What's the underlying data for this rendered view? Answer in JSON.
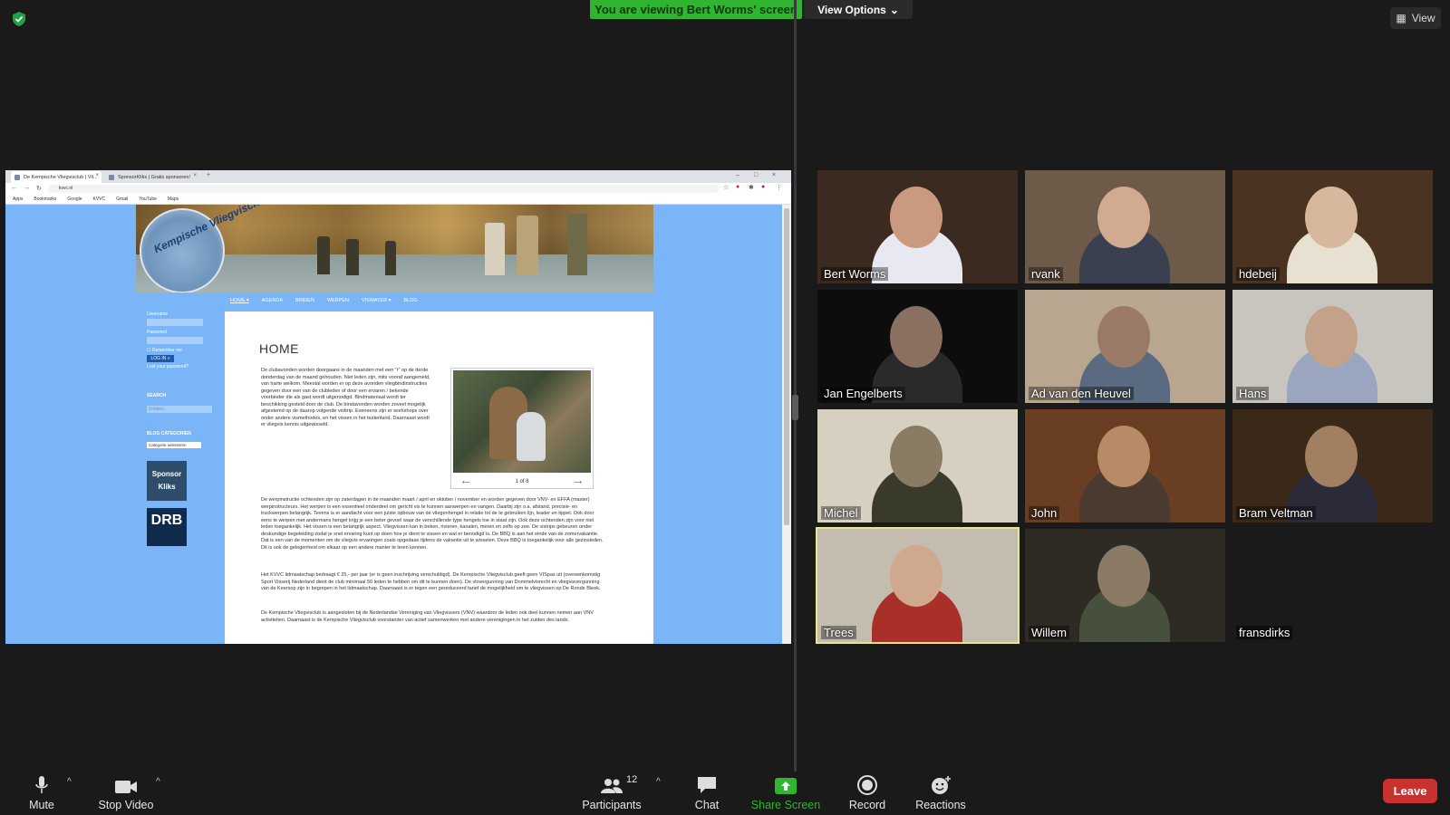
{
  "top": {
    "banner": "You are viewing Bert Worms' screen",
    "view_options": "View Options",
    "view_button": "View"
  },
  "browser": {
    "tabs": [
      "De Kempische Vliegvisclub | Vli...",
      "SponsorKliks | Gratis sponsoren!"
    ],
    "url": "kvvc.nl",
    "bookmarks": [
      "Apps",
      "Bookmarks",
      "Google",
      "KVVC",
      "Gmail",
      "YouTube",
      "Maps"
    ]
  },
  "site": {
    "logo_text": "Kempische Vliegvisclub",
    "nav": [
      "HOME ▾",
      "AGENDA",
      "BINDEN",
      "WERPEN",
      "VISWATER ▾",
      "BLOG"
    ],
    "sidebar": {
      "username": "Username",
      "password": "Password",
      "remember": "Remember me",
      "login": "LOG IN »",
      "lost": "Lost your password?",
      "search_head": "SEARCH",
      "search_placeholder": "Zoeken...",
      "blog_head": "BLOG CATEGORIEN",
      "category_select": "Categorie selecteren",
      "sponsor": "Sponsor Kliks",
      "drb": "DRB"
    },
    "title": "HOME",
    "para1": "De clubavonden worden doorgaans in de maanden met een \"r\" op de derde donderdag van de maand gehouden. Niet leden zijn, mits vooraf aangemeld, van harte welkom. Meestal worden er op deze avonden vliegbindinstructies gegeven door een van de clubleden of door een ervaren / bekende voorbinder die als gast wordt uitgenodigd. Bindmateriaal wordt ter beschikking gesteld door de club. De bindavonden worden zoveel mogelijk afgestemd op de daarop volgende visttrip. Eveneens zijn er workshops over onder andere vismethodes, en het vissen in het buitenland. Daarnaast wordt er vliegvis kennis uitgewisseld.",
    "slide_counter": "1 of 8",
    "para2": "De werpinstructie ochtenden zijn op zaterdagen in de maanden maart / april en oktober / november en worden gegeven door VNV- en EFFA (master) werpinstructeurs. Het werpen is een essentieel onderdeel om gericht vis te kunnen aanwerpen en vangen. Daarbij zijn o.a. afstand, precisie- en truckwerpen belangrijk. Tevens is er aandacht voor een juiste opbouw van de vliegenhengel in relatie tot de te gebruiken lijn, leader en tippet. Ook door eens te werpen met andermans hengel krijg je een beter gevoel waar de verschillende type hengels toe in staat zijn. Ook deze ochtenden zijn voor niet leden toegankelijk. Het vissen is een belangrijk aspect. Vliegvissen kan in beken, rivieren, kanalen, meren en zelfs op zee. De vistrips gebeuren onder deskundige begeleiding zodat je snel ervaring kunt op doen hoe je dient te vissen en wat er benodigd is. De BBQ is aan het einde van de zomervakantie. Dat is een van de momenten om de vliegvis ervaringen zoals opgedaan tijdens de vakantie uit te wisselen. Deze BBQ is toegankelijk voor alle gezinsleden. Dit is ook de gelegenheid om elkaar op een andere manier te leren kennen.",
    "para3": "Het KVVC lidmaatschap bedraagt € 25,- per jaar (er is geen inschrijving verschuldigd). De Kempische Vliegvisclub geeft geen VISpas uit (overeenkomstig Sport Visserij Nederland dient de club minimaal 50 leden te hebben om dit te kunnen doen). De vlovergunning van Dommelvisrecht en vliegvisvergunning van de Keersop zijn in begrepen in het lidmaatschap. Daarnaast is er tegen een gereduceerd tarief de mogelijkheid om te vliegvissen op De Ronde Bleek.",
    "para4": "De Kempische Vliegvisclub is aangesloten bij de Nederlandse Vereniging van Vliegvissers (VNV) waardoor de leden ook deel kunnen nemen aan VNV activiteiten. Daarnaast is de Kempische Vliegvisclub voorstander van actief samenwerken met andere verenigingen in het zuiden des lands."
  },
  "participants": [
    {
      "name": "Bert Worms",
      "bg": "#3b2a20",
      "skin": "#c99a80",
      "shirt": "#e8e8f0"
    },
    {
      "name": "rvank",
      "bg": "#6e5a48",
      "skin": "#d1aa90",
      "shirt": "#3a4050"
    },
    {
      "name": "hdebeij",
      "bg": "#4a3320",
      "skin": "#d8b89c",
      "shirt": "#e8e0d0"
    },
    {
      "name": "Jan Engelberts",
      "bg": "#0d0d0d",
      "skin": "#8a7060",
      "shirt": "#2a2a2a"
    },
    {
      "name": "Ad van den Heuvel",
      "bg": "#b8a690",
      "skin": "#9a7a66",
      "shirt": "#5a6a80"
    },
    {
      "name": "Hans",
      "bg": "#c8c4be",
      "skin": "#c4a28a",
      "shirt": "#9aa6c0"
    },
    {
      "name": "Michel",
      "bg": "#d6d0c0",
      "skin": "#8a7c62",
      "shirt": "#3a3a2a"
    },
    {
      "name": "John",
      "bg": "#6a3e22",
      "skin": "#b88a66",
      "shirt": "#4a3a30"
    },
    {
      "name": "Bram Veltman",
      "bg": "#3a2818",
      "skin": "#a08060",
      "shirt": "#2a2a38"
    },
    {
      "name": "Trees",
      "bg": "#c4bcae",
      "skin": "#cfa88e",
      "shirt": "#a83028"
    },
    {
      "name": "Willem",
      "bg": "#2e2a24",
      "skin": "#8a7a66",
      "shirt": "#46503c"
    },
    {
      "name": "fransdirks",
      "bg": "#1a1a1a",
      "skin": "",
      "shirt": ""
    }
  ],
  "toolbar": {
    "mute": "Mute",
    "stop_video": "Stop Video",
    "participants": "Participants",
    "participants_count": "12",
    "chat": "Chat",
    "share_screen": "Share Screen",
    "record": "Record",
    "reactions": "Reactions",
    "leave": "Leave"
  },
  "colors": {
    "accent_green": "#2fb52f",
    "leave_red": "#c7322f",
    "active_speaker": "#e3e88a"
  }
}
